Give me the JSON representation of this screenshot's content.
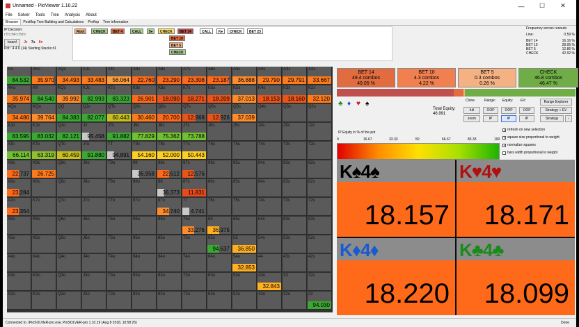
{
  "window": {
    "title": "Unnamed - PioViewer 1.10.22",
    "minimize": "—",
    "maximize": "☐",
    "close": "✕"
  },
  "menu": [
    "File",
    "Solver",
    "Tools",
    "Tree",
    "Analysis",
    "About"
  ],
  "tabs": [
    "Browser",
    "Postflop Tree Building and Calculations",
    "Preflop",
    "Tree information"
  ],
  "left_info": {
    "ip_decision": "IP Decision:",
    "line": "r:0:c:b4:c:5d:c",
    "board_button": "board",
    "board_cards": [
      "J♦",
      "7♠",
      "6♥"
    ],
    "pot": "Pot : 4 4 6 (14) Starting Stacks:#1"
  },
  "actions": {
    "row1": [
      {
        "label": "Root",
        "color": "#f4b183"
      },
      {
        "label": "CHECK",
        "color": "#a9d18e"
      },
      {
        "label": "BET 4",
        "color": "#e06c40"
      },
      {
        "label": "CALL",
        "color": "#a9d18e"
      },
      {
        "label": "5♦",
        "color": "#a9d18e"
      },
      {
        "label": "CHECK",
        "color": "#ffe066"
      },
      {
        "label": "BET 14",
        "color": "#c0504d"
      },
      {
        "label": "CALL",
        "color": "#ffffff"
      },
      {
        "label": "K♦",
        "color": "#ffffff"
      },
      {
        "label": "CHECK",
        "color": "#ffffff"
      },
      {
        "label": "BET 23",
        "color": "#ffffff"
      }
    ],
    "sub": [
      {
        "label": "BET 10",
        "color": "#e06c40"
      },
      {
        "label": "BET 5",
        "color": "#f4b183"
      },
      {
        "label": "CHECK",
        "color": "#a9d18e"
      }
    ]
  },
  "frequency": {
    "title": "Frequency across runouts:",
    "rows": [
      {
        "label": "Line:",
        "value": "0.59 %"
      },
      {
        "label": "BET 14",
        "value": "16.16 %"
      },
      {
        "label": "BET 10",
        "value": "28.05 %"
      },
      {
        "label": "BET 5",
        "value": "12.86 %"
      },
      {
        "label": "CHECK",
        "value": "42.92 %"
      }
    ]
  },
  "grid": {
    "labels": [
      [
        "AA",
        "AKs",
        "AQs",
        "AJs",
        "ATs",
        "A9s",
        "A8s",
        "A7s",
        "A6s",
        "A5s",
        "A4s",
        "A3s",
        "A2s"
      ],
      [
        "AKo",
        "KK",
        "KQs",
        "KJs",
        "KTs",
        "K9s",
        "K8s",
        "K7s",
        "K6s",
        "K5s",
        "K4s",
        "K3s",
        "K2s"
      ],
      [
        "AQo",
        "KQo",
        "QQ",
        "QJs",
        "QTs",
        "Q9s",
        "Q8s",
        "Q7s",
        "Q6s",
        "Q5s",
        "Q4s",
        "Q3s",
        "Q2s"
      ],
      [
        "AJo",
        "KJo",
        "QJo",
        "JJ",
        "JTs",
        "J9s",
        "J8s",
        "J7s",
        "J6s",
        "J5s",
        "J4s",
        "J3s",
        "J2s"
      ],
      [
        "ATo",
        "KTo",
        "QTo",
        "JTo",
        "TT",
        "T9s",
        "T8s",
        "T7s",
        "T6s",
        "T5s",
        "T4s",
        "T3s",
        "T2s"
      ],
      [
        "A9o",
        "K9o",
        "Q9o",
        "J9o",
        "T9o",
        "99",
        "98s",
        "97s",
        "96s",
        "95s",
        "94s",
        "93s",
        "92s"
      ],
      [
        "A8o",
        "K8o",
        "Q8o",
        "J8o",
        "T8o",
        "98o",
        "88",
        "87s",
        "86s",
        "85s",
        "84s",
        "83s",
        "82s"
      ],
      [
        "A7o",
        "K7o",
        "Q7o",
        "J7o",
        "T7o",
        "97o",
        "87o",
        "77",
        "76s",
        "75s",
        "74s",
        "73s",
        "72s"
      ],
      [
        "A6o",
        "K6o",
        "Q6o",
        "J6o",
        "T6o",
        "96o",
        "86o",
        "76o",
        "66",
        "65s",
        "64s",
        "63s",
        "62s"
      ],
      [
        "A5o",
        "K5o",
        "Q5o",
        "J5o",
        "T5o",
        "95o",
        "85o",
        "75o",
        "65o",
        "55",
        "54s",
        "53s",
        "52s"
      ],
      [
        "A4o",
        "K4o",
        "Q4o",
        "J4o",
        "T4o",
        "94o",
        "84o",
        "74o",
        "64o",
        "54o",
        "44",
        "43s",
        "42s"
      ],
      [
        "A3o",
        "K3o",
        "Q3o",
        "J3o",
        "T3o",
        "93o",
        "83o",
        "73o",
        "63o",
        "53o",
        "43o",
        "33",
        "32s"
      ],
      [
        "A2o",
        "K2o",
        "Q2o",
        "J2o",
        "T2o",
        "92o",
        "82o",
        "72o",
        "62o",
        "52o",
        "42o",
        "32o",
        "22"
      ]
    ],
    "values": [
      [
        "84.532",
        "35.970",
        "34.493",
        "33.483",
        "56.064",
        "22.760",
        "23.290",
        "23.308",
        "23.187",
        "36.888",
        "29.790",
        "29.791",
        "33.667"
      ],
      [
        "35.974",
        "84.540",
        "39.992",
        "82.993",
        "83.323",
        "26.901",
        "18.090",
        "18.271",
        "18.209",
        "37.013",
        "18.153",
        "18.160",
        "32.120"
      ],
      [
        "34.486",
        "39.764",
        "84.383",
        "82.077",
        "60.443",
        "30.460",
        "20.700",
        "12.968",
        "12.926",
        "37.039",
        "",
        "",
        ""
      ],
      [
        "83.595",
        "83.032",
        "82.121",
        "95.458",
        "91.882",
        "77.829",
        "75.362",
        "73.788",
        "",
        "",
        "",
        "",
        ""
      ],
      [
        "66.114",
        "63.319",
        "60.459",
        "91.880",
        "94.891",
        "54.160",
        "52.000",
        "50.443",
        "",
        "",
        "",
        "",
        ""
      ],
      [
        "22.737",
        "26.725",
        "",
        "",
        "",
        "36.958",
        "22.612",
        "12.576",
        "",
        "",
        "",
        "",
        ""
      ],
      [
        "23.284",
        "",
        "",
        "",
        "",
        "",
        "36.373",
        "11.831",
        "",
        "",
        "",
        "",
        ""
      ],
      [
        "23.354",
        "",
        "",
        "",
        "",
        "",
        "34.740",
        "4.741",
        "",
        "",
        "",
        "",
        ""
      ],
      [
        "",
        "",
        "",
        "",
        "",
        "",
        "",
        "33.276",
        "36.975",
        "",
        "",
        "",
        ""
      ],
      [
        "",
        "",
        "",
        "",
        "",
        "",
        "",
        "",
        "94.637",
        "36.850",
        "",
        "",
        ""
      ],
      [
        "",
        "",
        "",
        "",
        "",
        "",
        "",
        "",
        "",
        "32.853",
        "",
        "",
        ""
      ],
      [
        "",
        "",
        "",
        "",
        "",
        "",
        "",
        "",
        "",
        "",
        "32.843",
        "",
        ""
      ],
      [
        "",
        "",
        "",
        "",
        "",
        "",
        "",
        "",
        "",
        "",
        "",
        "",
        "94.030"
      ]
    ],
    "colors": [
      [
        "#3aa832",
        "#ff7a1a",
        "#ff7a1a",
        "#ff7a1a",
        "#ff9d3a",
        "#ff6a1a",
        "#ff6a1a",
        "#ff6a1a",
        "#ff6a1a",
        "#ff8c2a",
        "#ff7a1a",
        "#ff7a1a",
        "#ff7a1a"
      ],
      [
        "#ff7a1a",
        "#3aa832",
        "#ff8c2a",
        "#3aa832",
        "#3aa832",
        "#ff6a1a",
        "#e8541a",
        "#e8541a",
        "#e8541a",
        "#ff8c2a",
        "#e8541a",
        "#e8541a",
        "#ff7a1a"
      ],
      [
        "#ff7a1a",
        "#ff8c2a",
        "#3aa832",
        "#3aa832",
        "#c8c020",
        "#ff7a1a",
        "#ff6a1a",
        "#e8541a",
        "#e8541a",
        "#ff8c2a",
        "",
        "",
        ""
      ],
      [
        "#3aa832",
        "#3aa832",
        "#3aa832",
        "#c8c8c8",
        "#3aa832",
        "#70c030",
        "#70c030",
        "#70c030",
        "",
        "",
        "",
        "",
        ""
      ],
      [
        "#70c030",
        "#90c030",
        "#c8c020",
        "#3aa832",
        "#c8c8c8",
        "#ffd020",
        "#ffd020",
        "#ffd020",
        "",
        "",
        "",
        "",
        ""
      ],
      [
        "#ff6a1a",
        "#ff7a1a",
        "",
        "",
        "",
        "#c8c8c8",
        "#ff6a1a",
        "#e8541a",
        "",
        "",
        "",
        "",
        ""
      ],
      [
        "#ff6a1a",
        "",
        "",
        "",
        "",
        "",
        "#c8c8c8",
        "#e84a1a",
        "",
        "",
        "",
        "",
        ""
      ],
      [
        "#ff6a1a",
        "",
        "",
        "",
        "",
        "",
        "#ff8c2a",
        "#c8c8c8",
        "",
        "",
        "",
        "",
        ""
      ],
      [
        "",
        "",
        "",
        "",
        "",
        "",
        "",
        "#ff8c2a",
        "#ffb020",
        "",
        "",
        "",
        ""
      ],
      [
        "",
        "",
        "",
        "",
        "",
        "",
        "",
        "",
        "#3aa832",
        "#ffb020",
        "",
        "",
        ""
      ],
      [
        "",
        "",
        "",
        "",
        "",
        "",
        "",
        "",
        "",
        "#ffb020",
        "",
        "",
        ""
      ],
      [
        "",
        "",
        "",
        "",
        "",
        "",
        "",
        "",
        "",
        "",
        "#ffb020",
        "",
        ""
      ],
      [
        "",
        "",
        "",
        "",
        "",
        "",
        "",
        "",
        "",
        "",
        "",
        "",
        "#3aa832"
      ]
    ],
    "fills": [
      [
        1,
        0.9,
        1,
        1,
        1,
        0.95,
        1,
        1,
        0.9,
        1,
        1,
        1,
        1
      ],
      [
        1,
        1,
        1,
        1,
        1,
        1,
        1,
        1,
        1,
        1,
        1,
        1,
        1
      ],
      [
        1,
        1,
        1,
        1,
        1,
        1,
        1,
        0.55,
        0.55,
        1,
        0,
        0,
        0
      ],
      [
        1,
        1,
        1,
        0.3,
        1,
        1,
        1,
        1,
        0,
        0,
        0,
        0,
        0
      ],
      [
        1,
        1,
        1,
        1,
        0.3,
        1,
        1,
        1,
        0,
        0,
        0,
        0,
        0
      ],
      [
        0.5,
        1,
        0,
        0,
        0,
        0.3,
        0.5,
        0.5,
        0,
        0,
        0,
        0,
        0
      ],
      [
        0.5,
        0,
        0,
        0,
        0,
        0,
        0.3,
        1,
        0,
        0,
        0,
        0,
        0
      ],
      [
        0.5,
        0,
        0,
        0,
        0,
        0,
        0.5,
        0.3,
        0,
        0,
        0,
        0,
        0
      ],
      [
        0,
        0,
        0,
        0,
        0,
        0,
        0,
        0.5,
        0.5,
        0,
        0,
        0,
        0
      ],
      [
        0,
        0,
        0,
        0,
        0,
        0,
        0,
        0,
        0.5,
        1,
        0,
        0,
        0
      ],
      [
        0,
        0,
        0,
        0,
        0,
        0,
        0,
        0,
        0,
        1,
        0,
        0,
        0
      ],
      [
        0,
        0,
        0,
        0,
        0,
        0,
        0,
        0,
        0,
        0,
        1,
        0,
        0
      ],
      [
        0,
        0,
        0,
        0,
        0,
        0,
        0,
        0,
        0,
        0,
        0,
        0,
        1
      ]
    ]
  },
  "strategy": [
    {
      "label": "BET 14",
      "combos": "49.4 combos",
      "pct": "49.05 %",
      "color": "#e06c40"
    },
    {
      "label": "BET 10",
      "combos": "4.3 combos",
      "pct": "4.22 %",
      "color": "#f08050"
    },
    {
      "label": "BET 5",
      "combos": "0.3 combos",
      "pct": "0.26 %",
      "color": "#f4b183"
    },
    {
      "label": "CHECK",
      "combos": "46.8 combos",
      "pct": "46.47 %",
      "color": "#70ad47"
    }
  ],
  "strategy_bar": [
    {
      "fraction": 0.49,
      "color": "#c0504d"
    },
    {
      "fraction": 0.04,
      "color": "#e06c40"
    },
    {
      "fraction": 0.005,
      "color": "#f4b183"
    },
    {
      "fraction": 0.465,
      "color": "#70ad47"
    }
  ],
  "suits": [
    {
      "glyph": "♣",
      "color": "#1a8a1a"
    },
    {
      "glyph": "♦",
      "color": "#1a4ad0"
    },
    {
      "glyph": "♥",
      "color": "#d01a1a"
    },
    {
      "glyph": "♠",
      "color": "#000000"
    }
  ],
  "equity": {
    "total_label": "Total Equity:",
    "total_value": "46.991",
    "ip_equity_label": "IP Equity in % of the pot",
    "ticks": [
      "0",
      "16.67",
      "33.33",
      "50",
      "66.67",
      "83.33",
      "100"
    ]
  },
  "controls": {
    "headers": [
      "Clone",
      "Range:",
      "Equity:",
      "EV:"
    ],
    "buttons": [
      "full",
      "OOP",
      "OOP",
      "OOP",
      "zoom",
      "IP",
      "IP",
      "IP"
    ],
    "range_explorer": "Range Explorer",
    "strategy_ev": "Strategy + EV",
    "strategy": "Strategy",
    "arrow": "‹",
    "checks": [
      "refresh on new selection",
      "square size proportional to weight",
      "normalize squares",
      "bars width proportional to weight"
    ]
  },
  "big_cards": [
    {
      "rank1": "K",
      "suit1": "♠",
      "rank2": "4",
      "suit2": "♠",
      "suit_color": "#000000",
      "value": "18.157"
    },
    {
      "rank1": "K",
      "suit1": "♥",
      "rank2": "4",
      "suit2": "♥",
      "suit_color": "#b01010",
      "value": "18.171"
    },
    {
      "rank1": "K",
      "suit1": "♦",
      "rank2": "4",
      "suit2": "♦",
      "suit_color": "#1a5ad0",
      "value": "18.220"
    },
    {
      "rank1": "K",
      "suit1": "♣",
      "rank2": "4",
      "suit2": "♣",
      "suit_color": "#1a8a1a",
      "value": "18.099"
    }
  ],
  "status": {
    "left": "Connected to .\\PioSOLVER-pro.exe, PioSOLVER-pro 1.10.19 (Aug 8 2018, 10:58:25)",
    "right": "Done"
  }
}
